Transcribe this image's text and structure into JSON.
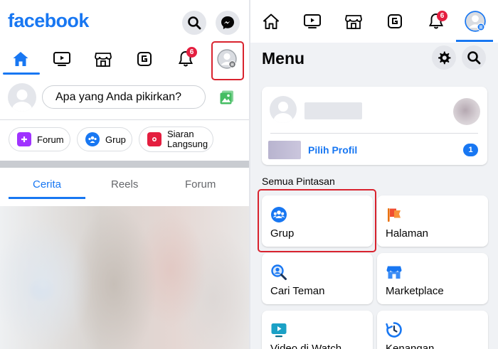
{
  "left_panel": {
    "logo": "facebook",
    "header_buttons": [
      "search-icon",
      "messenger-icon"
    ],
    "nav_icons": [
      "home-icon",
      "watch-icon",
      "marketplace-icon",
      "gaming-icon",
      "bell-icon",
      "profile-menu-icon"
    ],
    "notification_count": "6",
    "composer_placeholder": "Apa yang Anda pikirkan?",
    "chips": {
      "forum": "Forum",
      "grup": "Grup",
      "live_line1": "Siaran",
      "live_line2": "Langsung"
    },
    "story_tabs": {
      "cerita": "Cerita",
      "reels": "Reels",
      "forum": "Forum"
    },
    "colors": {
      "brand": "#1877f2",
      "highlight_box": "#d9232e"
    }
  },
  "right_panel": {
    "notification_count": "6",
    "menu_title": "Menu",
    "profile_card": {
      "pilih_profil": "Pilih Profil",
      "profile_badge": "1"
    },
    "section_label": "Semua Pintasan",
    "shortcuts": {
      "grup": "Grup",
      "halaman": "Halaman",
      "cari_teman": "Cari Teman",
      "marketplace": "Marketplace",
      "video_watch": "Video di Watch",
      "kenangan": "Kenangan"
    }
  }
}
